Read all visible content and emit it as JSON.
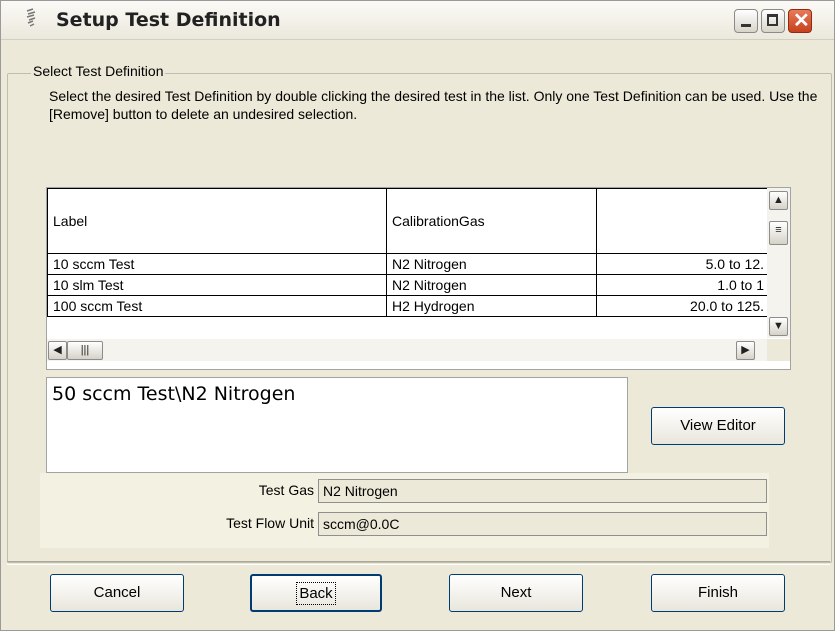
{
  "window": {
    "title": "Setup Test Definition"
  },
  "group": {
    "legend": "Select Test Definition",
    "description": "Select the desired Test Definition by double clicking the desired test in the list.  Only one Test Definition can be used.  Use the [Remove] button to delete an undesired selection."
  },
  "table": {
    "columns": [
      "Label",
      "CalibrationGas",
      ""
    ],
    "rows": [
      [
        "10 sccm Test",
        "N2 Nitrogen",
        "5.0 to 12."
      ],
      [
        "10 slm Test",
        "N2 Nitrogen",
        "1.0 to 1"
      ],
      [
        "100 sccm Test",
        "H2 Hydrogen",
        "20.0 to 125."
      ]
    ]
  },
  "selection": {
    "text": "50 sccm Test\\N2 Nitrogen"
  },
  "buttons": {
    "view_editor": "View Editor",
    "cancel": "Cancel",
    "back": "Back",
    "next": "Next",
    "finish": "Finish"
  },
  "fields": {
    "test_gas_label": "Test Gas",
    "test_gas_value": "N2 Nitrogen",
    "test_flow_unit_label": "Test Flow Unit",
    "test_flow_unit_value": "sccm@0.0C"
  }
}
